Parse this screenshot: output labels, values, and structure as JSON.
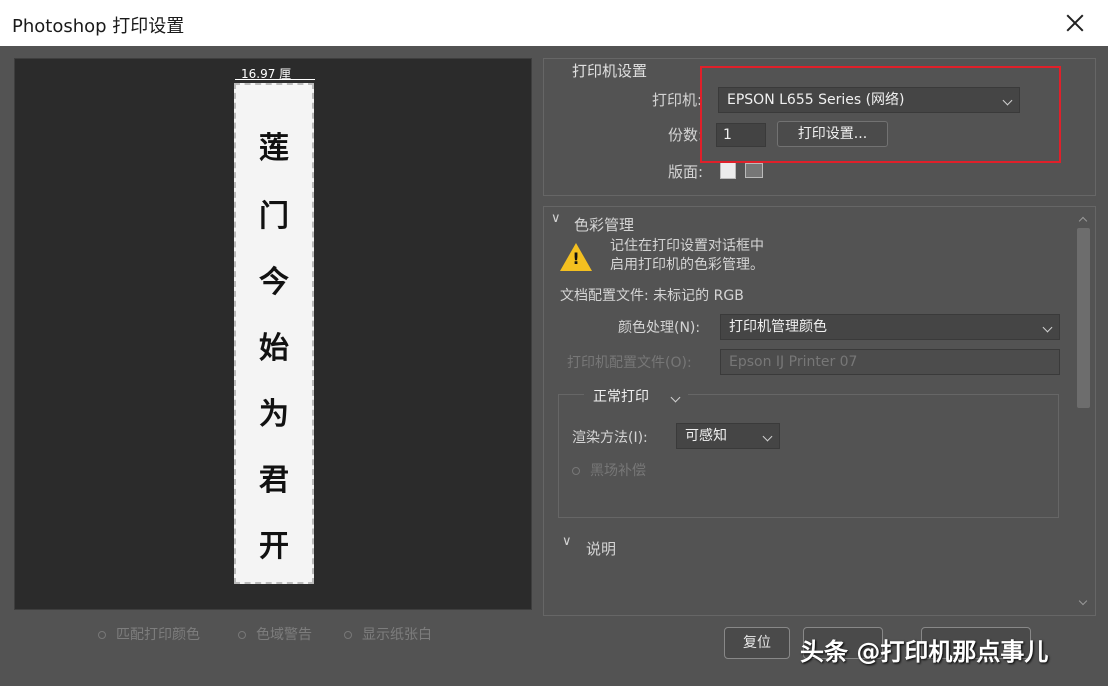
{
  "window": {
    "title": "Photoshop 打印设置"
  },
  "preview": {
    "ruler": "16.97 厘",
    "chars": [
      "莲",
      "门",
      "今",
      "始",
      "为",
      "君",
      "开"
    ]
  },
  "preview_options": [
    {
      "label": "匹配打印颜色"
    },
    {
      "label": "色域警告"
    },
    {
      "label": "显示纸张白"
    }
  ],
  "printer_setup": {
    "legend": "打印机设置",
    "printer_label": "打印机:",
    "printer_value": "EPSON L655 Series (网络)",
    "copies_label": "份数:",
    "copies_value": "1",
    "print_settings_button": "打印设置...",
    "layout_label": "版面:"
  },
  "color_management": {
    "header": "色彩管理",
    "warning_line1": "记住在打印设置对话框中",
    "warning_line2": "启用打印机的色彩管理。",
    "doc_profile": "文档配置文件: 未标记的 RGB",
    "color_handling_label": "颜色处理(N):",
    "color_handling_value": "打印机管理颜色",
    "printer_profile_label": "打印机配置文件(O):",
    "printer_profile_value": "Epson IJ Printer 07",
    "mode_value": "正常打印",
    "rendering_label": "渲染方法(I):",
    "rendering_value": "可感知",
    "bpc_label": "黑场补偿"
  },
  "description": {
    "header": "说明"
  },
  "buttons": {
    "reset": "复位"
  },
  "watermark": "头条 @打印机那点事儿",
  "colors": {
    "highlight_box": "#e0202a",
    "warning": "#f4c020"
  }
}
